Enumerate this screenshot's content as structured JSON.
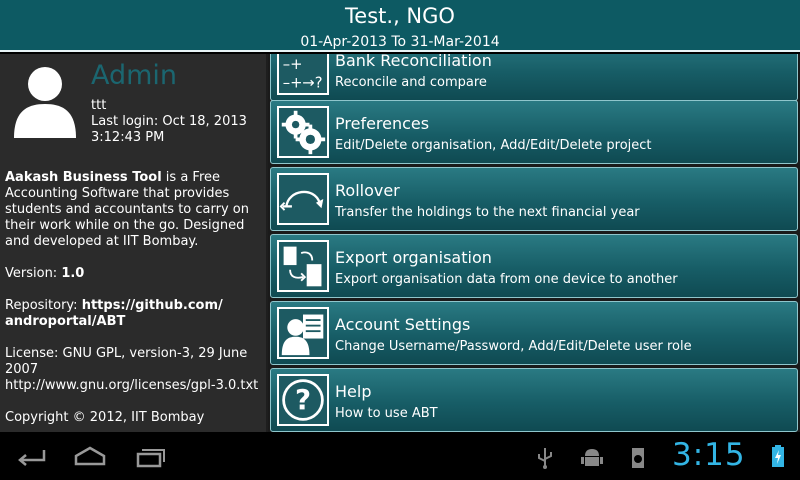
{
  "header": {
    "title": "Test., NGO",
    "period": "01-Apr-2013 To 31-Mar-2014"
  },
  "profile": {
    "role": "Admin",
    "username": "ttt",
    "last_login_line1": "Last login: Oct 18, 2013",
    "last_login_line2": "3:12:43 PM"
  },
  "about": {
    "app_name": "Aakash Business Tool",
    "description": " is a Free Accounting Software that provides students and accountants to carry on their work while on the go. Designed and developed at IIT Bombay.",
    "version_label": "Version: ",
    "version": "1.0",
    "repo_label": "Repository: ",
    "repo_url": "https://github.com/ androportal/ABT",
    "license_line1": "License: GNU GPL, version-3, 29 June 2007",
    "license_line2": "http://www.gnu.org/licenses/gpl-3.0.txt",
    "copyright": "Copyright © 2012, IIT Bombay"
  },
  "menu": [
    {
      "label": "Bank Reconciliation",
      "desc": "Reconcile and compare",
      "icon": "bank-reconciliation-icon"
    },
    {
      "label": "Preferences",
      "desc": "Edit/Delete organisation, Add/Edit/Delete project",
      "icon": "gears-icon"
    },
    {
      "label": "Rollover",
      "desc": "Transfer the holdings to the next financial year",
      "icon": "rollover-arrow-icon"
    },
    {
      "label": "Export organisation",
      "desc": "Export organisation data from one device to another",
      "icon": "export-devices-icon"
    },
    {
      "label": "Account Settings",
      "desc": "Change Username/Password, Add/Edit/Delete user role",
      "icon": "account-person-icon"
    },
    {
      "label": "Help",
      "desc": "How to use ABT",
      "icon": "question-mark-icon"
    }
  ],
  "status_bar": {
    "time": "3:15"
  },
  "colors": {
    "header_bg": "#0d5a63",
    "menu_teal": "#175d66",
    "clock": "#33b5e5"
  }
}
